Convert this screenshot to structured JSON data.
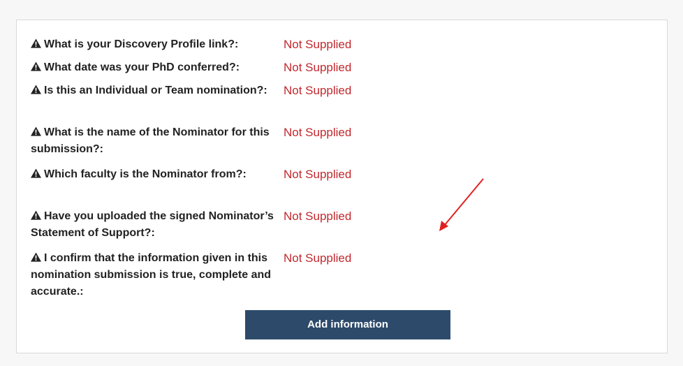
{
  "form": {
    "fields": [
      {
        "question": "What is your Discovery Profile link?:",
        "answer": "Not Supplied"
      },
      {
        "question": "What date was your PhD conferred?:",
        "answer": "Not Supplied"
      },
      {
        "question": "Is this an Individual or Team nomination?:",
        "answer": "Not Supplied"
      },
      {
        "question": "What is the name of the Nominator for this submission?:",
        "answer": "Not Supplied"
      },
      {
        "question": "Which faculty is the Nominator from?:",
        "answer": "Not Supplied"
      },
      {
        "question": "Have you uploaded the signed Nominator’s Statement of Support?:",
        "answer": "Not Supplied"
      },
      {
        "question": "I confirm that the information given in this nomination submission is true, complete and accurate.:",
        "answer": "Not Supplied"
      }
    ],
    "add_button_label": "Add information"
  },
  "icons": {
    "field_icon": "warning-icon",
    "annotation": "red-arrow"
  },
  "colors": {
    "answer_text": "#c2272d",
    "button_bg": "#2d4a6b",
    "arrow": "#e02020"
  }
}
